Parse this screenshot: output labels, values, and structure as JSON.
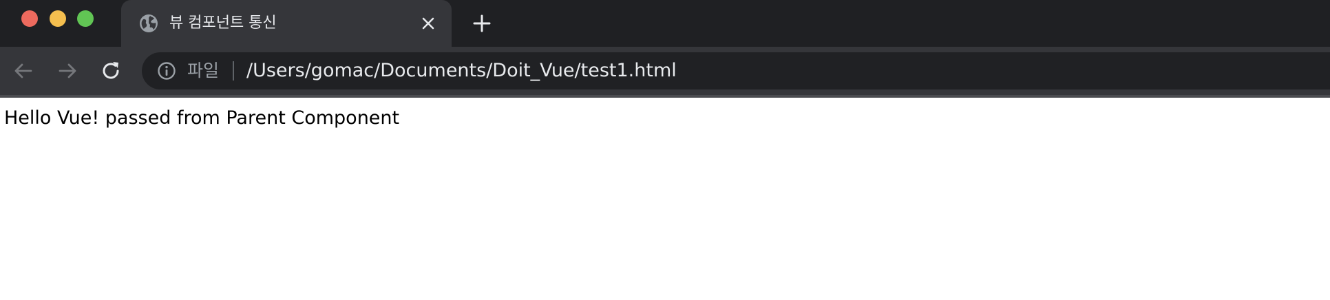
{
  "window": {
    "traffic_lights": [
      {
        "name": "close",
        "color": "#ed6a5e"
      },
      {
        "name": "minimize",
        "color": "#f5bf4f"
      },
      {
        "name": "zoom",
        "color": "#61c554"
      }
    ]
  },
  "tab": {
    "title": "뷰 컴포넌트 통신",
    "favicon": "globe-icon",
    "close_icon": "close-icon"
  },
  "new_tab_icon": "plus-icon",
  "toolbar": {
    "back_icon": "arrow-left-icon",
    "forward_icon": "arrow-right-icon",
    "reload_icon": "reload-icon"
  },
  "omnibox": {
    "info_icon": "info-icon",
    "scheme_label": "파일",
    "url": "/Users/gomac/Documents/Doit_Vue/test1.html"
  },
  "page": {
    "text": "Hello Vue! passed from Parent Component"
  },
  "colors": {
    "tabstrip_bg": "#1f2023",
    "toolbar_bg": "#35363a",
    "omnibox_bg": "#202124",
    "page_bg": "#ffffff"
  }
}
